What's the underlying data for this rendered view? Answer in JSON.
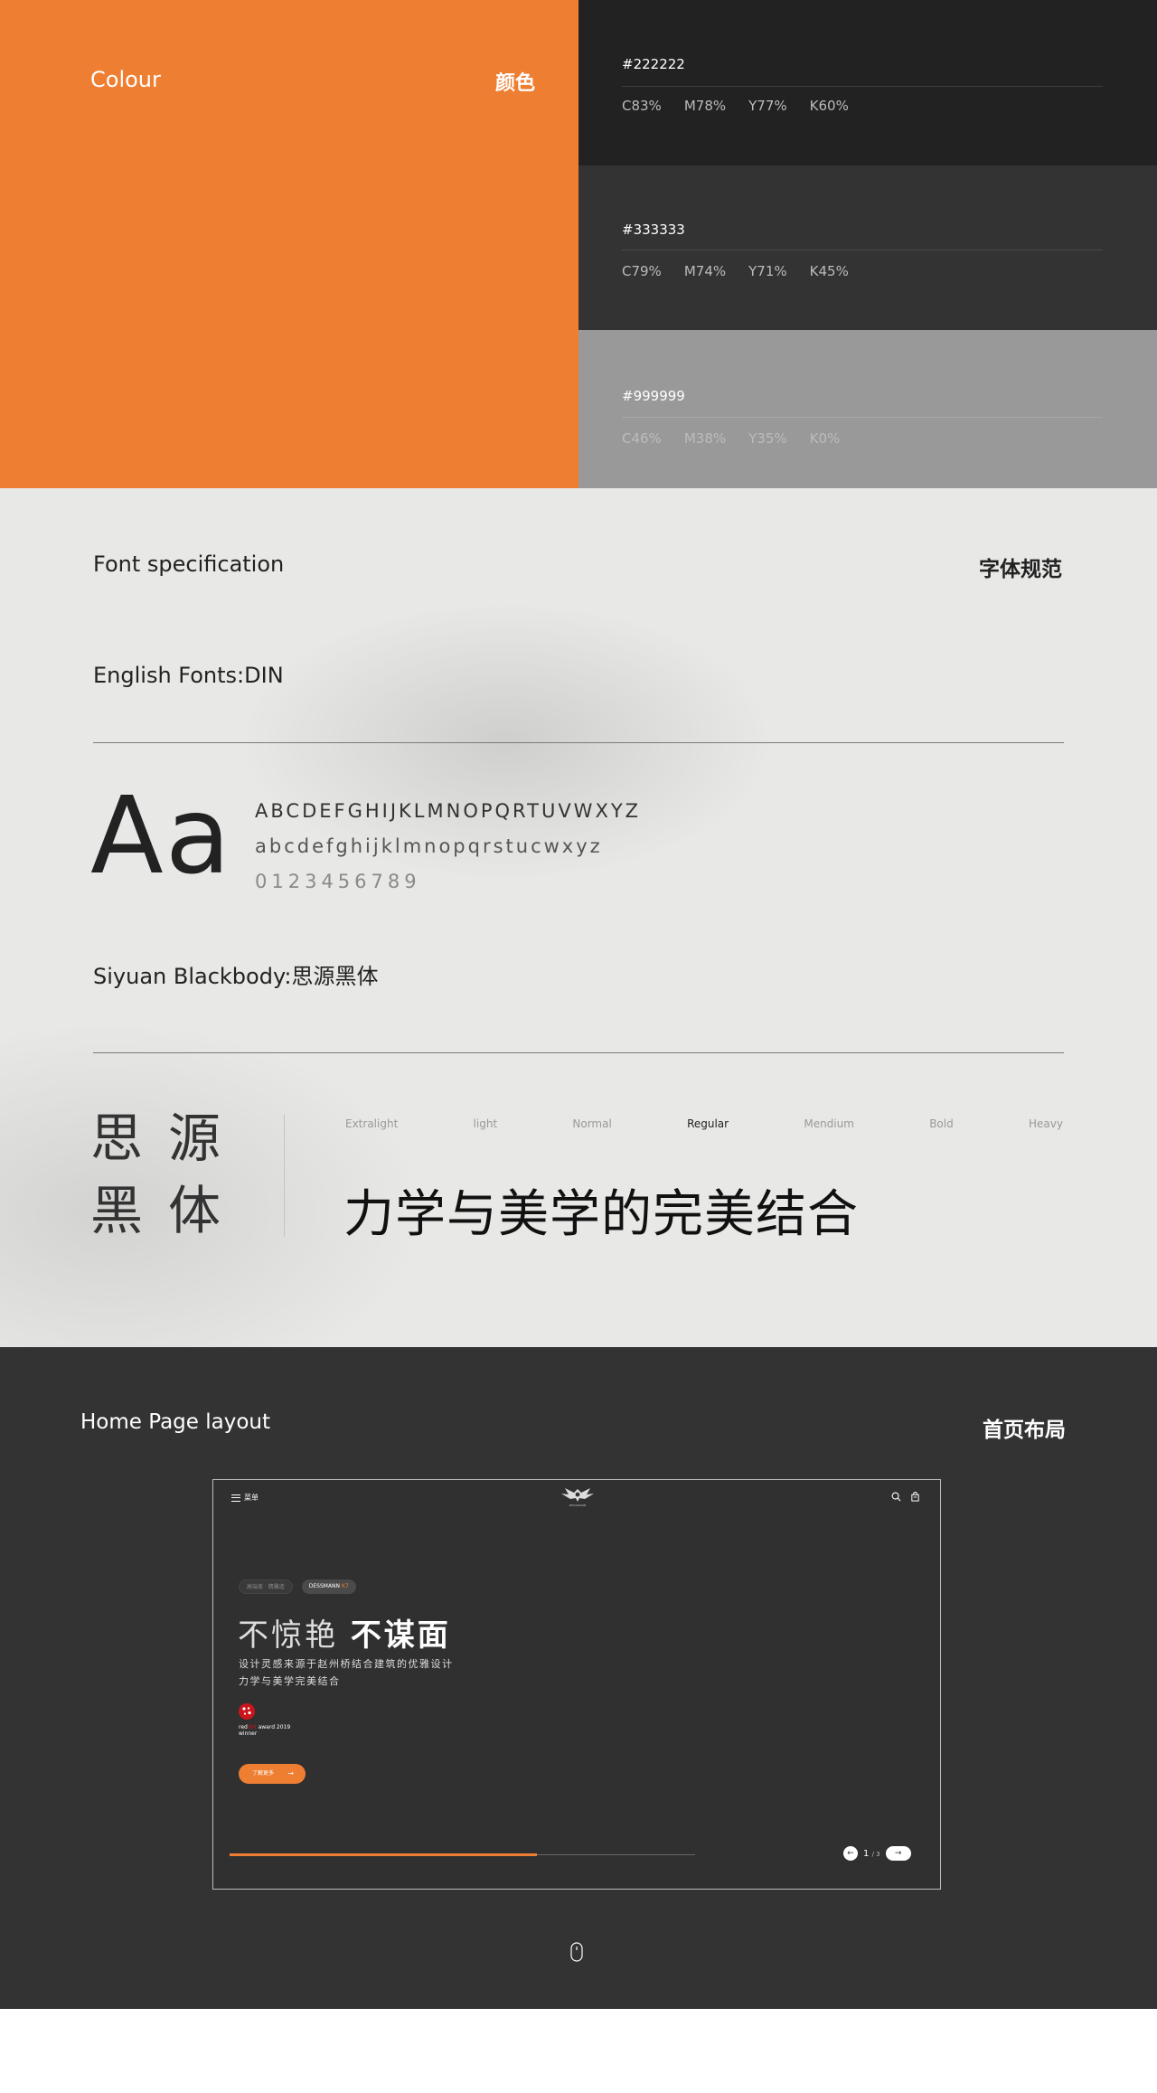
{
  "colour": {
    "title": "Colour",
    "title_cn": "颜色",
    "primary_color": "#ED7E32",
    "swatches": [
      {
        "hex": "#222222",
        "c": "C83%",
        "m": "M78%",
        "y": "Y77%",
        "k": "K60%"
      },
      {
        "hex": "#333333",
        "c": "C79%",
        "m": "M74%",
        "y": "Y71%",
        "k": "K45%"
      },
      {
        "hex": "#999999",
        "c": "C46%",
        "m": "M38%",
        "y": "Y35%",
        "k": "K0%"
      }
    ]
  },
  "fonts": {
    "title": "Font specification",
    "title_cn": "字体规范",
    "english_label": "English Fonts:DIN",
    "sample_aa": "Aa",
    "uppercase": "ABCDEFGHIJKLMNOPQRTUVWXYZ",
    "lowercase": "abcdefghijklmnopqrstucwxyz",
    "digits": "0123456789",
    "chinese_label": "Siyuan Blackbody:思源黑体",
    "chinese_big_line1": "思源",
    "chinese_big_line2": "黑体",
    "weights": [
      "Extralight",
      "light",
      "Normal",
      "Regular",
      "Mendium",
      "Bold",
      "Heavy"
    ],
    "active_weight": "Regular",
    "slogan": "力学与美学的完美结合"
  },
  "home": {
    "title": "Home  Page layout",
    "title_cn": "首页布局",
    "mock": {
      "menu_label": "菜单",
      "logo_text": "DESSMANN",
      "icons": [
        "search-icon",
        "bag-icon"
      ],
      "chip_dim": "高端美 · 精雕造",
      "chip_brand": "DESSMANN",
      "chip_model": "K7",
      "headline_light": "不惊艳",
      "headline_bold": "不谋面",
      "desc_line1": "设计灵感来源于赵州桥结合建筑的优雅设计",
      "desc_line2": "力学与美学完美结合",
      "award_red": "red",
      "award_dot": "dot",
      "award_suffix": " award 2019",
      "award_winner": "winner",
      "cta_label": "了解更多",
      "progress": 0.66,
      "page_current": "1",
      "page_total": "/ 3",
      "accent": "#ED7E32"
    }
  }
}
